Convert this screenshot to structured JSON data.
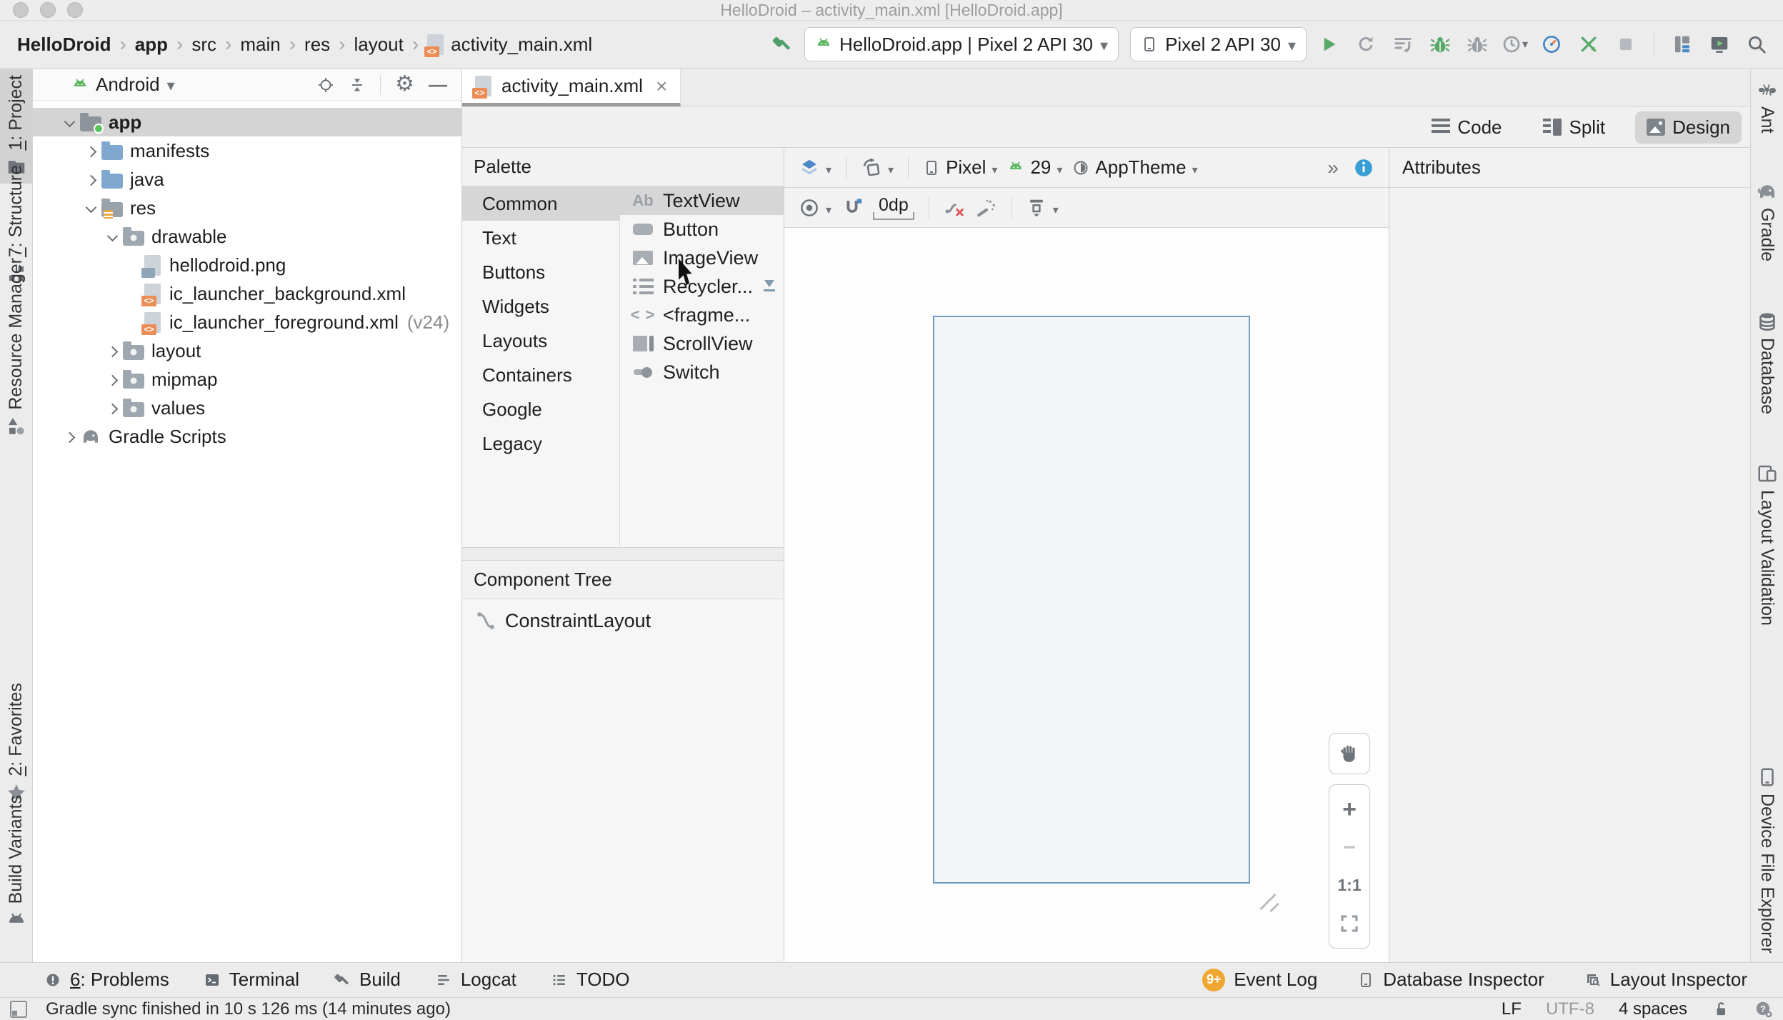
{
  "colors": {
    "chrome": "#ececec",
    "panel": "#f6f6f6",
    "selection_gray": "#d5d5d5",
    "android_green": "#5fb865",
    "run_green": "#59a869",
    "info_blue": "#389fd6",
    "xml_orange": "#ec8d56",
    "badge_orange": "#f0a732",
    "device_frame_blue": "#6d9dc5"
  },
  "titlebar": {
    "title": "HelloDroid – activity_main.xml [HelloDroid.app]"
  },
  "toolbar": {
    "breadcrumbs": [
      "HelloDroid",
      "app",
      "src",
      "main",
      "res",
      "layout",
      "activity_main.xml"
    ],
    "run_config": {
      "label": "HelloDroid.app | Pixel 2 API 30",
      "icon": "android"
    },
    "device_select": {
      "label": "Pixel 2 API 30",
      "icon": "phone"
    },
    "actions": [
      {
        "name": "run",
        "icon": "run"
      },
      {
        "name": "apply-changes",
        "icon": "circ-arrow"
      },
      {
        "name": "apply-code-changes",
        "icon": "bars-arrow"
      },
      {
        "name": "debug",
        "icon": "bug-green"
      },
      {
        "name": "attach-debugger",
        "icon": "bug-gray"
      },
      {
        "name": "profile",
        "icon": "clock",
        "caret": true
      },
      {
        "name": "profiler",
        "icon": "gauge"
      },
      {
        "name": "restart-arrows",
        "icon": "green-x"
      },
      {
        "name": "stop",
        "icon": "stop"
      },
      {
        "name": "divider"
      },
      {
        "name": "project-structure",
        "icon": "proj-struct"
      },
      {
        "name": "device-manager",
        "icon": "device-mgr"
      },
      {
        "name": "search-everywhere",
        "icon": "search"
      }
    ]
  },
  "left_strip": {
    "top": [
      {
        "key": "project",
        "mnemonic": "1",
        "label": ": Project",
        "icon": "tw-project",
        "selected": true
      },
      {
        "key": "structure",
        "mnemonic": "7",
        "label": ": Structure",
        "icon": "tw-structure"
      },
      {
        "key": "resource-manager",
        "label": "Resource Manager",
        "icon": "tw-resource"
      }
    ],
    "bottom": [
      {
        "key": "favorites",
        "mnemonic": "2",
        "label": ": Favorites",
        "icon": "tw-star"
      },
      {
        "key": "build-variants",
        "label": "Build Variants",
        "icon": "tw-android"
      }
    ]
  },
  "project_panel": {
    "view_selector": "Android",
    "tree": [
      {
        "label": "app",
        "indent": 0,
        "chevron": "down",
        "icon": "f-app",
        "selected": true,
        "bold": true
      },
      {
        "label": "manifests",
        "indent": 1,
        "chevron": "right",
        "icon": "f-blue"
      },
      {
        "label": "java",
        "indent": 1,
        "chevron": "right",
        "icon": "f-blue"
      },
      {
        "label": "res",
        "indent": 1,
        "chevron": "down",
        "icon": "f-res"
      },
      {
        "label": "drawable",
        "indent": 2,
        "chevron": "down",
        "icon": "f-pkg"
      },
      {
        "label": "hellodroid.png",
        "indent": 3,
        "icon": "file-png"
      },
      {
        "label": "ic_launcher_background.xml",
        "indent": 3,
        "icon": "file-xml"
      },
      {
        "label": "ic_launcher_foreground.xml",
        "indent": 3,
        "icon": "file-xml",
        "suffix": "(v24)"
      },
      {
        "label": "layout",
        "indent": 2,
        "chevron": "right",
        "icon": "f-pkg"
      },
      {
        "label": "mipmap",
        "indent": 2,
        "chevron": "right",
        "icon": "f-pkg"
      },
      {
        "label": "values",
        "indent": 2,
        "chevron": "right",
        "icon": "f-pkg"
      },
      {
        "label": "Gradle Scripts",
        "indent": 0,
        "chevron": "right",
        "icon": "gradle"
      }
    ]
  },
  "editor": {
    "tab": {
      "label": "activity_main.xml",
      "icon": "file-xml"
    },
    "modes": [
      {
        "label": "Code",
        "icon": "code"
      },
      {
        "label": "Split",
        "icon": "split"
      },
      {
        "label": "Design",
        "icon": "design",
        "active": true
      }
    ]
  },
  "palette": {
    "title": "Palette",
    "selected_category": "Common",
    "categories": [
      "Common",
      "Text",
      "Buttons",
      "Widgets",
      "Layouts",
      "Containers",
      "Google",
      "Legacy"
    ],
    "components": [
      {
        "label": "TextView",
        "icon": "cmp-textview",
        "selected": true
      },
      {
        "label": "Button",
        "icon": "cmp-button"
      },
      {
        "label": "ImageView",
        "icon": "cmp-imageview"
      },
      {
        "label": "Recycler...",
        "icon": "cmp-recycler",
        "download": true
      },
      {
        "label": "<fragme...",
        "icon": "cmp-fragment"
      },
      {
        "label": "ScrollView",
        "icon": "cmp-scrollview"
      },
      {
        "label": "Switch",
        "icon": "cmp-switch"
      }
    ]
  },
  "component_tree": {
    "title": "Component Tree",
    "items": [
      {
        "label": "ConstraintLayout",
        "icon": "constraint"
      }
    ]
  },
  "design_toolbar": {
    "device_label": "Pixel",
    "api_label": "29",
    "theme_label": "AppTheme",
    "margin_label": "0dp"
  },
  "canvas": {
    "zoom_label": "1:1"
  },
  "attributes": {
    "title": "Attributes"
  },
  "right_strip": [
    {
      "key": "ant",
      "label": "Ant",
      "icon": "tw-ant"
    },
    {
      "key": "gradle",
      "label": "Gradle",
      "icon": "tw-gradle"
    },
    {
      "key": "database",
      "label": "Database",
      "icon": "tw-database"
    },
    {
      "key": "layout-validation",
      "label": "Layout Validation",
      "icon": "tw-layoutval"
    },
    {
      "key": "device-file-explorer",
      "label": "Device File Explorer",
      "icon": "tw-phone"
    }
  ],
  "bottom_bar": {
    "left": [
      {
        "key": "problems",
        "mnemonic": "6",
        "label": ": Problems",
        "icon": "bb-problems"
      },
      {
        "key": "terminal",
        "label": "Terminal",
        "icon": "bb-terminal"
      },
      {
        "key": "build",
        "label": "Build",
        "icon": "bb-build"
      },
      {
        "key": "logcat",
        "label": "Logcat",
        "icon": "bb-logcat"
      },
      {
        "key": "todo",
        "label": "TODO",
        "icon": "bb-todo"
      }
    ],
    "right": [
      {
        "key": "event-log",
        "label": "Event Log",
        "badge": "9+"
      },
      {
        "key": "database-inspector",
        "label": "Database Inspector",
        "icon": "phone"
      },
      {
        "key": "layout-inspector",
        "label": "Layout Inspector",
        "icon": "bb-layoutinspector"
      }
    ]
  },
  "status_bar": {
    "message": "Gradle sync finished in 10 s 126 ms (14 minutes ago)",
    "line_ending": "LF",
    "encoding": "UTF-8",
    "indent_style": "4 spaces"
  }
}
